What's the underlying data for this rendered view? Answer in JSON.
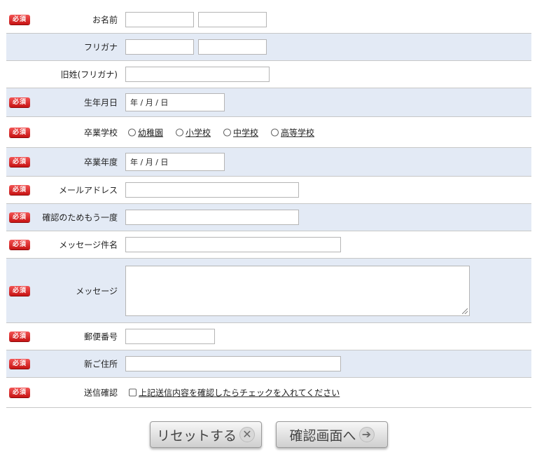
{
  "required_badge": "必須",
  "rows": {
    "name": {
      "label": "お名前"
    },
    "furigana": {
      "label": "フリガナ"
    },
    "maiden_name": {
      "label": "旧姓(フリガナ)"
    },
    "birthdate": {
      "label": "生年月日",
      "value": "年 / 月 / 日"
    },
    "school": {
      "label": "卒業学校",
      "options": [
        "幼稚園",
        "小学校",
        "中学校",
        "高等学校"
      ]
    },
    "grad_year": {
      "label": "卒業年度",
      "value": "年 / 月 / 日"
    },
    "email": {
      "label": "メールアドレス"
    },
    "email_confirm": {
      "label": "確認のためもう一度"
    },
    "subject": {
      "label": "メッセージ件名"
    },
    "message": {
      "label": "メッセージ"
    },
    "postal": {
      "label": "郵便番号"
    },
    "address": {
      "label": "新ご住所"
    },
    "confirm": {
      "label": "送信確認",
      "checkbox_label": "上記送信内容を確認したらチェックを入れてください"
    }
  },
  "buttons": {
    "reset": {
      "label": "リセットする",
      "icon": "close-circle-icon"
    },
    "confirm": {
      "label": "確認画面へ",
      "icon": "arrow-right-circle-icon"
    }
  },
  "colors": {
    "alt_row": "#e3eaf5",
    "required_badge": "#d81e1e"
  }
}
